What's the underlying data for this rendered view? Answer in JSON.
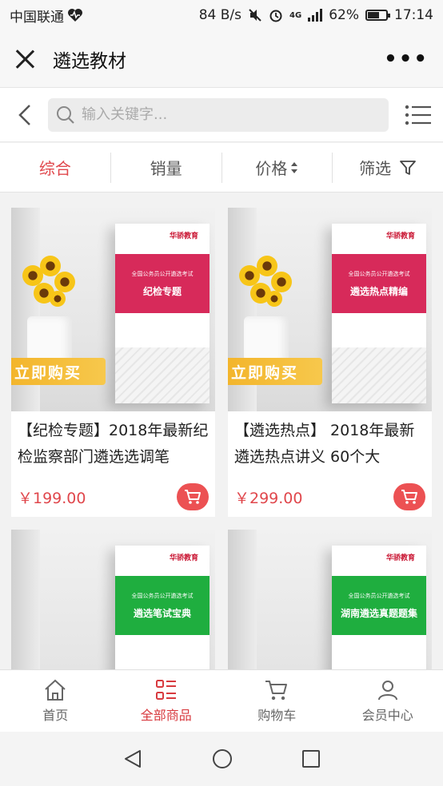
{
  "status": {
    "carrier": "中国联通",
    "speed": "84 B/s",
    "network": "4G",
    "battery": "62%",
    "battery_level": 0.62,
    "time": "17:14"
  },
  "titlebar": {
    "title": "遴选教材",
    "more": "•••"
  },
  "search": {
    "placeholder": "输入关键字..."
  },
  "sort_tabs": [
    {
      "label": "综合"
    },
    {
      "label": "销量"
    },
    {
      "label": "价格"
    },
    {
      "label": "筛选"
    }
  ],
  "products": [
    {
      "image_cover_title": "纪检专题",
      "image_cover_subtitle": "全国公务员公开遴选考试",
      "image_cover_logo": "华骄教育",
      "image_buy_banner": "立即购买",
      "title": "【纪检专题】2018年最新纪检监察部门遴选选调笔",
      "price": "￥199.00",
      "cover_color": "#d72a5a"
    },
    {
      "image_cover_title": "遴选热点精编",
      "image_cover_subtitle": "全国公务员公开遴选考试",
      "image_cover_logo": "华骄教育",
      "image_buy_banner": "立即购买",
      "title": "【遴选热点】 2018年最新遴选热点讲义 60个大",
      "price": "￥299.00",
      "cover_color": "#d72a5a"
    },
    {
      "image_cover_title": "遴选笔试宝典",
      "image_cover_subtitle": "全国公务员公开遴选考试",
      "image_cover_logo": "华骄教育",
      "cover_color": "#1fae3f"
    },
    {
      "image_cover_title": "湖南遴选真题题集",
      "image_cover_subtitle": "全国公务员公开遴选考试",
      "image_cover_logo": "华骄教育",
      "cover_color": "#1fae3f"
    }
  ],
  "bottom_nav": [
    {
      "label": "首页",
      "icon": "home-icon"
    },
    {
      "label": "全部商品",
      "icon": "grid-list-icon"
    },
    {
      "label": "购物车",
      "icon": "cart-icon"
    },
    {
      "label": "会员中心",
      "icon": "user-icon"
    }
  ],
  "colors": {
    "accent": "#e0474c",
    "price": "#e0474c",
    "cart_button": "#ec5153"
  }
}
